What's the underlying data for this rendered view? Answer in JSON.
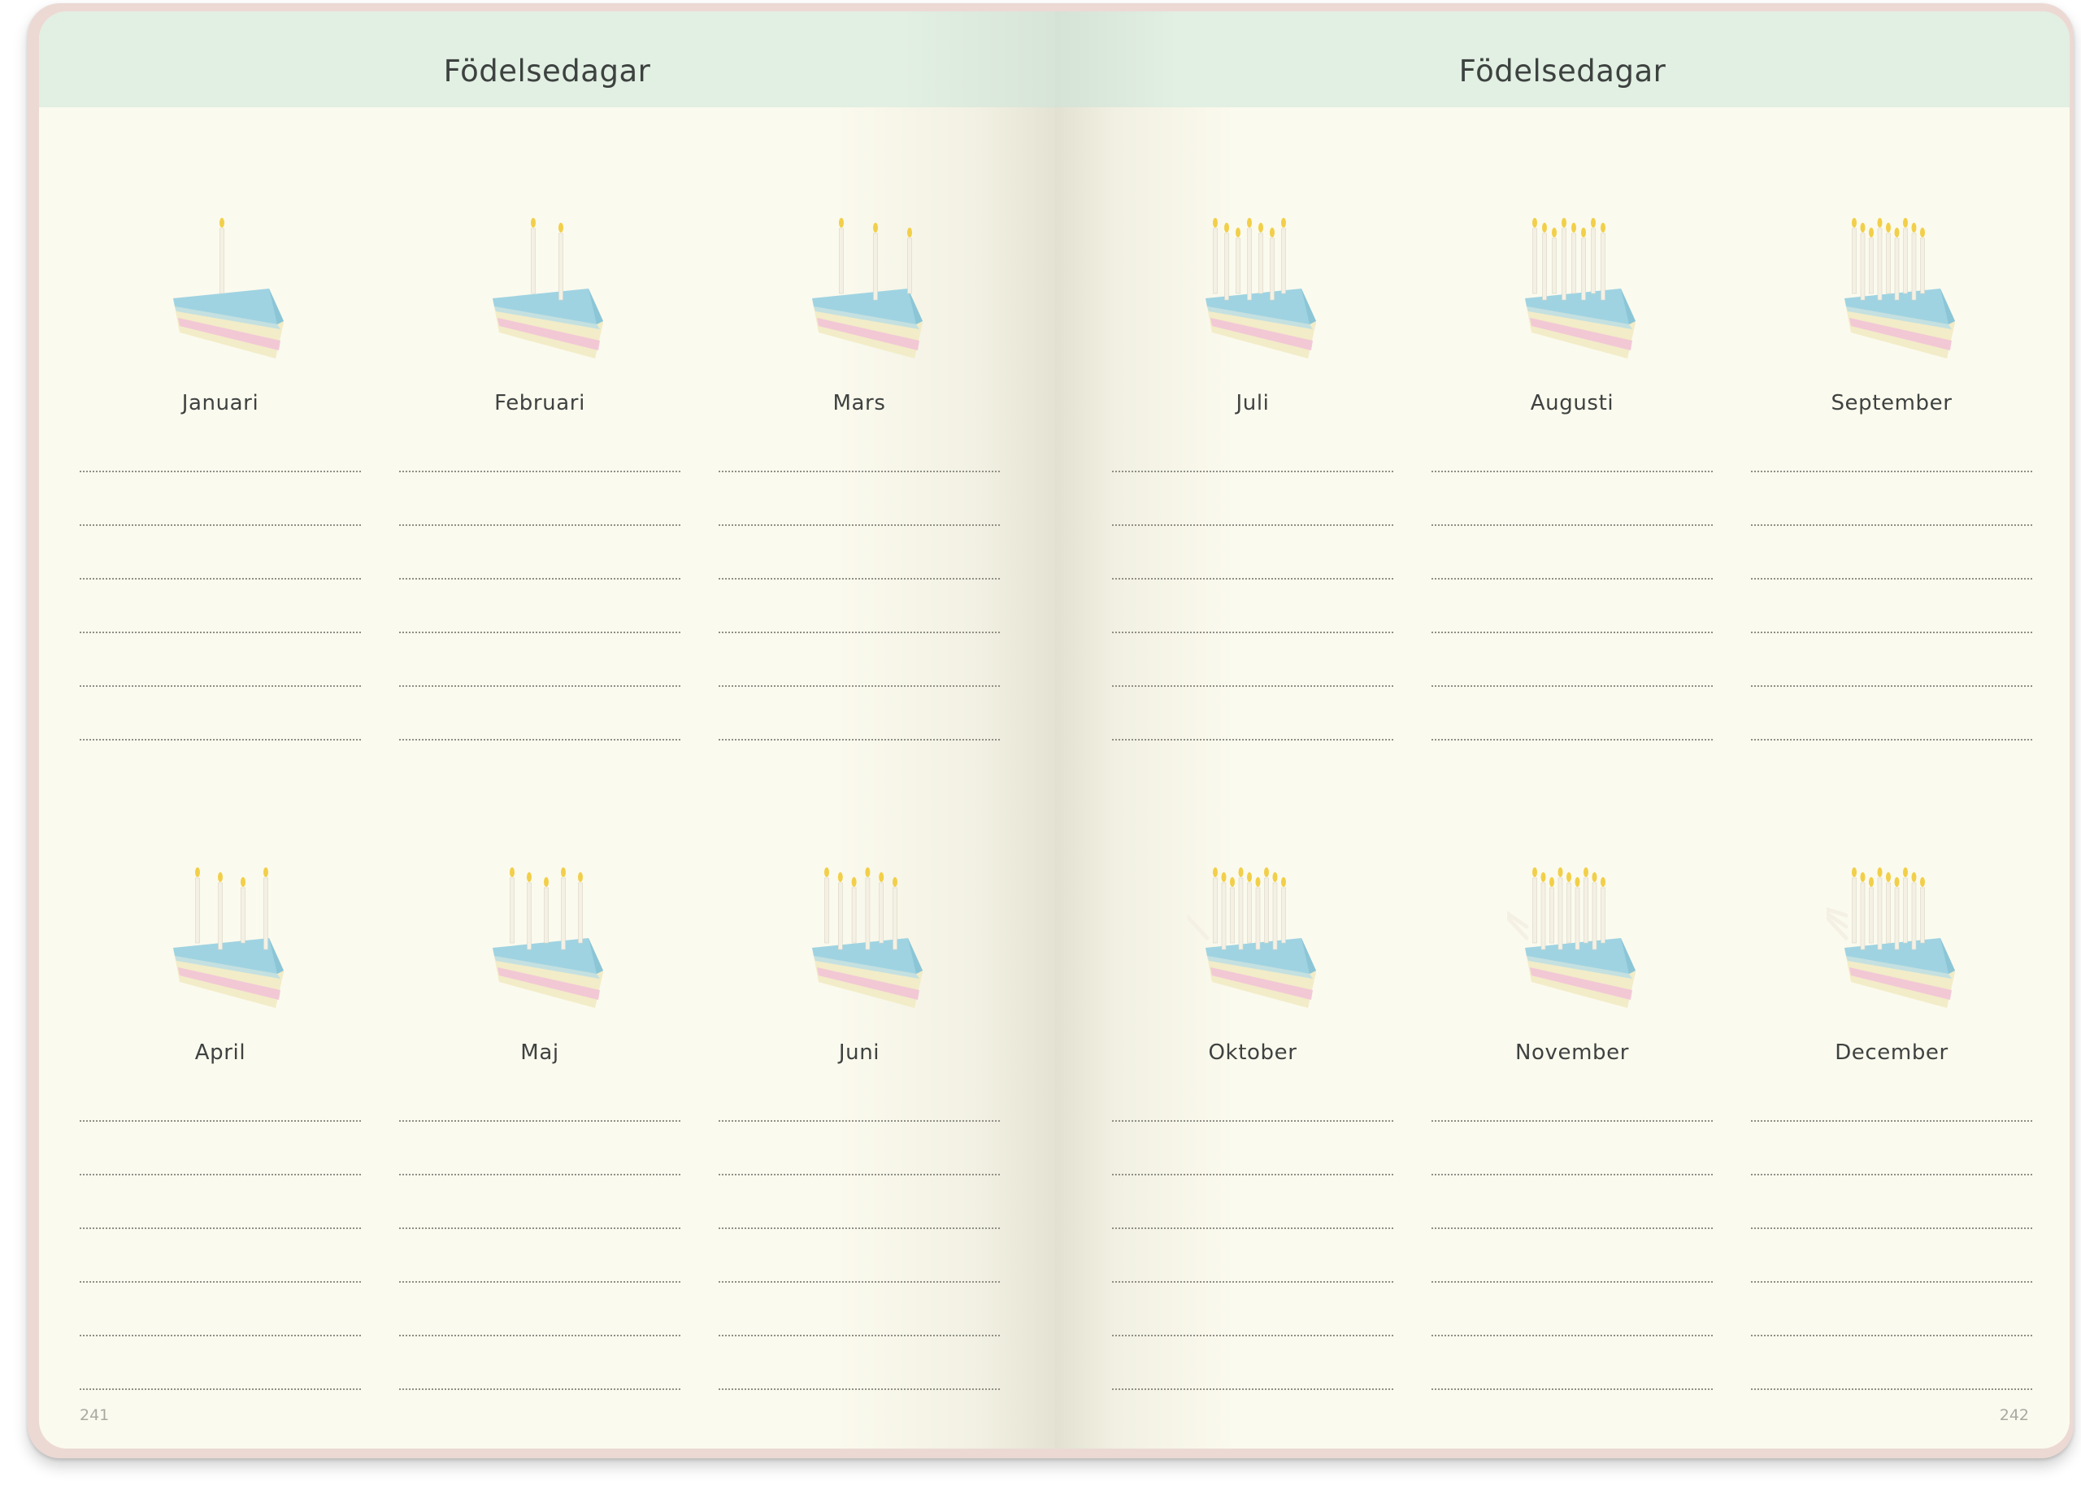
{
  "left_page": {
    "title": "Födelsedagar",
    "page_number": "241",
    "months": [
      {
        "name": "Januari",
        "candles": 1
      },
      {
        "name": "Februari",
        "candles": 2
      },
      {
        "name": "Mars",
        "candles": 3
      },
      {
        "name": "April",
        "candles": 4
      },
      {
        "name": "Maj",
        "candles": 5
      },
      {
        "name": "Juni",
        "candles": 6
      }
    ]
  },
  "right_page": {
    "title": "Födelsedagar",
    "page_number": "242",
    "months": [
      {
        "name": "Juli",
        "candles": 7
      },
      {
        "name": "Augusti",
        "candles": 8
      },
      {
        "name": "September",
        "candles": 9
      },
      {
        "name": "Oktober",
        "candles": 10
      },
      {
        "name": "November",
        "candles": 11
      },
      {
        "name": "December",
        "candles": 12
      }
    ]
  },
  "colors": {
    "header_band": "#e2efe3",
    "paper": "#fbfaee",
    "cake_frosting": "#9fd3e2",
    "cake_sponge": "#f2ecc8",
    "cake_filling": "#f2c4d6",
    "candle": "#f4f1e4",
    "flame": "#f2cf4a"
  },
  "icons": [
    "cake-slice-icon"
  ]
}
